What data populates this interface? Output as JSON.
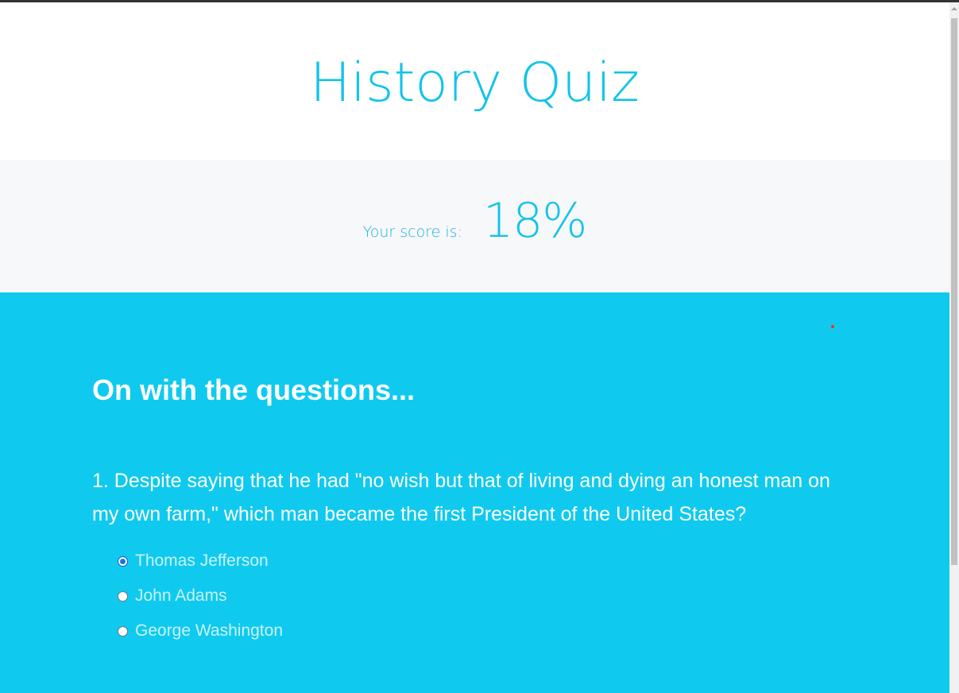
{
  "header": {
    "title": "History Quiz"
  },
  "score": {
    "label": "Your score is:",
    "value": "18%"
  },
  "questions_section": {
    "heading": "On with the questions...",
    "question": {
      "text": "1. Despite saying that he had \"no wish but that of living and dying an honest man on my own farm,\" which man became the first President of the United States?",
      "options": [
        {
          "label": "Thomas Jefferson",
          "checked": true
        },
        {
          "label": "John Adams",
          "checked": false
        },
        {
          "label": "George Washington",
          "checked": false
        }
      ]
    }
  },
  "colors": {
    "accent": "#13c3ea",
    "section_background": "#0fcaee",
    "score_background": "#f7f8fa"
  }
}
